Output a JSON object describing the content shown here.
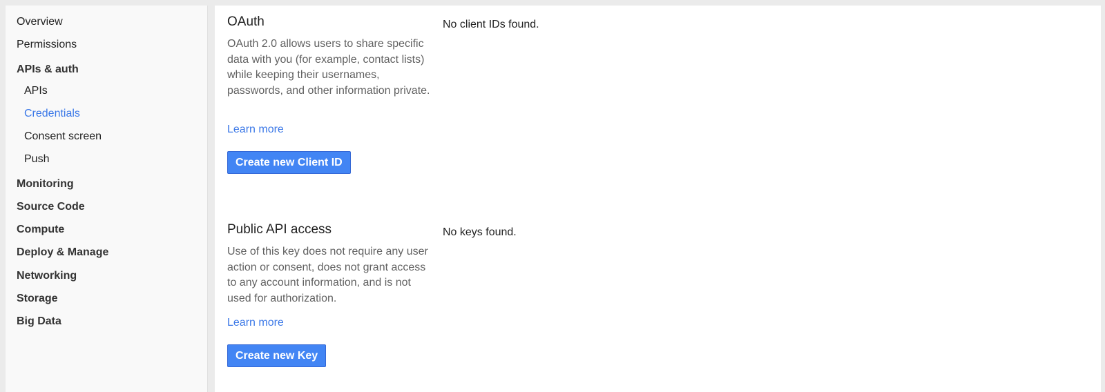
{
  "sidebar": {
    "items": [
      {
        "label": "Overview"
      },
      {
        "label": "Permissions"
      },
      {
        "label": "APIs & auth"
      },
      {
        "label": "APIs"
      },
      {
        "label": "Credentials"
      },
      {
        "label": "Consent screen"
      },
      {
        "label": "Push"
      },
      {
        "label": "Monitoring"
      },
      {
        "label": "Source Code"
      },
      {
        "label": "Compute"
      },
      {
        "label": "Deploy & Manage"
      },
      {
        "label": "Networking"
      },
      {
        "label": "Storage"
      },
      {
        "label": "Big Data"
      }
    ]
  },
  "oauth": {
    "title": "OAuth",
    "description": "OAuth 2.0 allows users to share specific data with you (for example, contact lists) while keeping their usernames, passwords, and other information private.",
    "learn_more": "Learn more",
    "button": "Create new Client ID",
    "empty_message": "No client IDs found."
  },
  "public_api": {
    "title": "Public API access",
    "description": "Use of this key does not require any user action or consent, does not grant access to any account information, and is not used for authorization.",
    "learn_more": "Learn more",
    "button": "Create new Key",
    "empty_message": "No keys found."
  },
  "colors": {
    "link": "#3b78e7",
    "button": "#4285f4"
  }
}
